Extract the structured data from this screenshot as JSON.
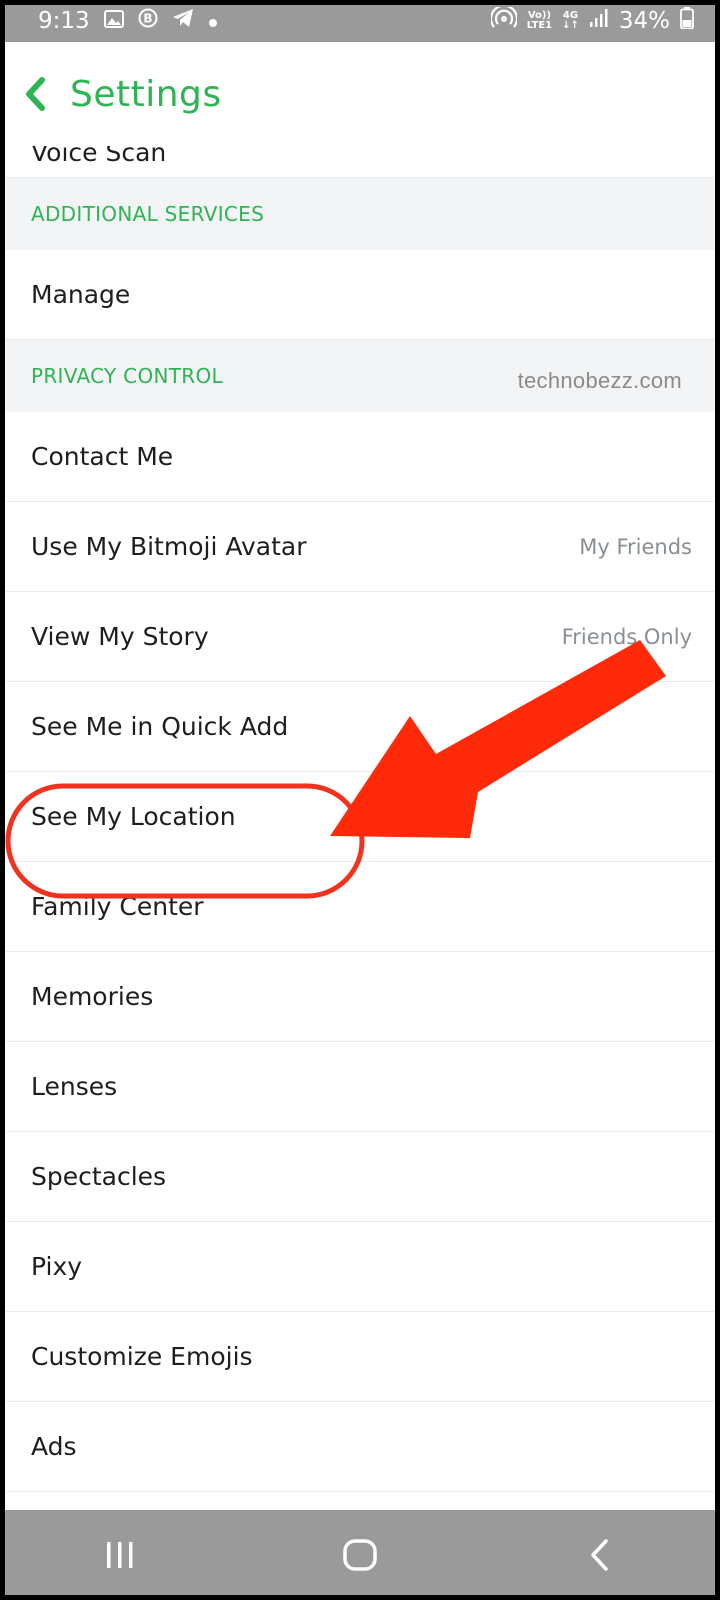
{
  "status_bar": {
    "time": "9:13",
    "network_top": "Vo))",
    "network_bottom": "LTE1",
    "signal_type_top": "4G",
    "signal_type_bottom": "↓↑",
    "battery_text": "34%",
    "icons": [
      "image-icon",
      "b-badge-icon",
      "telegram-icon",
      "dot-icon",
      "hotspot-icon",
      "signal-icon",
      "battery-icon"
    ]
  },
  "header": {
    "title": "Settings",
    "back_icon": "chevron-left-icon"
  },
  "list": {
    "top_partial_item": "Voice Scan",
    "section_additional": "ADDITIONAL SERVICES",
    "manage": "Manage",
    "section_privacy": "PRIVACY CONTROL",
    "watermark": "technobezz.com",
    "items": [
      {
        "label": "Contact Me",
        "value": ""
      },
      {
        "label": "Use My Bitmoji Avatar",
        "value": "My Friends"
      },
      {
        "label": "View My Story",
        "value": "Friends Only"
      },
      {
        "label": "See Me in Quick Add",
        "value": ""
      },
      {
        "label": "See My Location",
        "value": ""
      },
      {
        "label": "Family Center",
        "value": ""
      },
      {
        "label": "Memories",
        "value": ""
      },
      {
        "label": "Lenses",
        "value": ""
      },
      {
        "label": "Spectacles",
        "value": ""
      },
      {
        "label": "Pixy",
        "value": ""
      },
      {
        "label": "Customize Emojis",
        "value": ""
      },
      {
        "label": "Ads",
        "value": ""
      }
    ]
  },
  "annotation": {
    "highlight_color": "#f0321e",
    "arrow_color": "#ff2a0a"
  },
  "nav_bar": {
    "icons": [
      "recents-icon",
      "home-icon",
      "back-icon"
    ]
  },
  "colors": {
    "accent": "#2fb454",
    "status_bar": "#9a9a9a",
    "section_bg": "#f2f4f5"
  }
}
